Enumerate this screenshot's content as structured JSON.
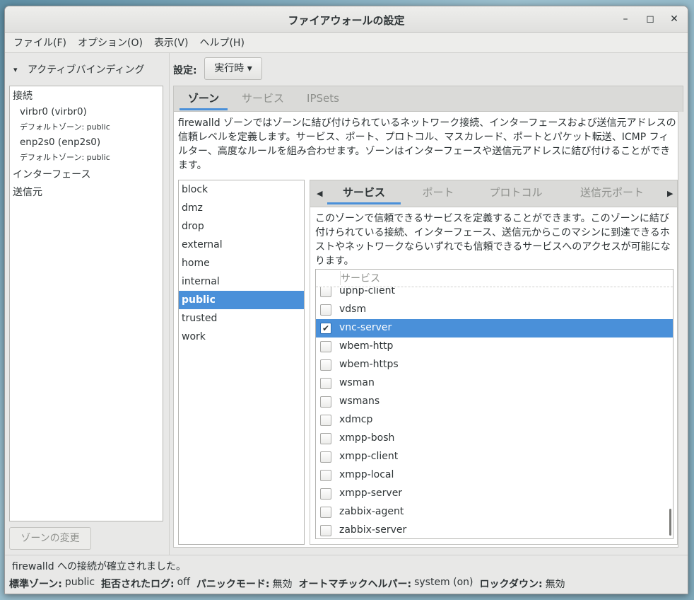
{
  "window": {
    "title": "ファイアウォールの設定",
    "minimize": "–",
    "maximize": "◻",
    "close": "✕"
  },
  "menu": [
    "ファイル(F)",
    "オプション(O)",
    "表示(V)",
    "ヘルプ(H)"
  ],
  "active_bindings": {
    "heading": "アクティブバインディング",
    "connections_label": "接続",
    "connections": [
      {
        "name": "virbr0 (virbr0)",
        "default_zone": "デフォルトゾーン: public"
      },
      {
        "name": "enp2s0 (enp2s0)",
        "default_zone": "デフォルトゾーン: public"
      }
    ],
    "interfaces_label": "インターフェース",
    "sources_label": "送信元",
    "change_zone_button": "ゾーンの変更"
  },
  "config": {
    "label": "設定:",
    "value": "実行時 ▾"
  },
  "outer_tabs": [
    "ゾーン",
    "サービス",
    "IPSets"
  ],
  "zone_description": "firewalld ゾーンではゾーンに結び付けられているネットワーク接続、インターフェースおよび送信元アドレスの信頼レベルを定義します。サービス、ポート、プロトコル、マスカレード、ポートとパケット転送、ICMP フィルター、高度なルールを組み合わせます。ゾーンはインターフェースや送信元アドレスに結び付けることができます。",
  "zones": [
    "block",
    "dmz",
    "drop",
    "external",
    "home",
    "internal",
    "public",
    "trusted",
    "work"
  ],
  "selected_zone": "public",
  "inner_tabs": [
    "サービス",
    "ポート",
    "プロトコル",
    "送信元ポート"
  ],
  "services_description": "このゾーンで信頼できるサービスを定義することができます。このゾーンに結び付けられている接続、インターフェース、送信元からこのマシンに到達できるホストやネットワークならいずれでも信頼できるサービスへのアクセスが可能になります。",
  "services_column": "サービス",
  "services": [
    {
      "name": "upnp-client",
      "checked": false
    },
    {
      "name": "vdsm",
      "checked": false
    },
    {
      "name": "vnc-server",
      "checked": true
    },
    {
      "name": "wbem-http",
      "checked": false
    },
    {
      "name": "wbem-https",
      "checked": false
    },
    {
      "name": "wsman",
      "checked": false
    },
    {
      "name": "wsmans",
      "checked": false
    },
    {
      "name": "xdmcp",
      "checked": false
    },
    {
      "name": "xmpp-bosh",
      "checked": false
    },
    {
      "name": "xmpp-client",
      "checked": false
    },
    {
      "name": "xmpp-local",
      "checked": false
    },
    {
      "name": "xmpp-server",
      "checked": false
    },
    {
      "name": "zabbix-agent",
      "checked": false
    },
    {
      "name": "zabbix-server",
      "checked": false
    }
  ],
  "status": {
    "message": "firewalld への接続が確立されました。",
    "items": [
      {
        "key": "標準ゾーン:",
        "value": "public"
      },
      {
        "key": "拒否されたログ:",
        "value": "off"
      },
      {
        "key": "パニックモード:",
        "value": "無効"
      },
      {
        "key": "オートマチックヘルパー:",
        "value": "system (on)"
      },
      {
        "key": "ロックダウン:",
        "value": "無効"
      }
    ]
  },
  "colors": {
    "accent": "#4a90d9"
  }
}
